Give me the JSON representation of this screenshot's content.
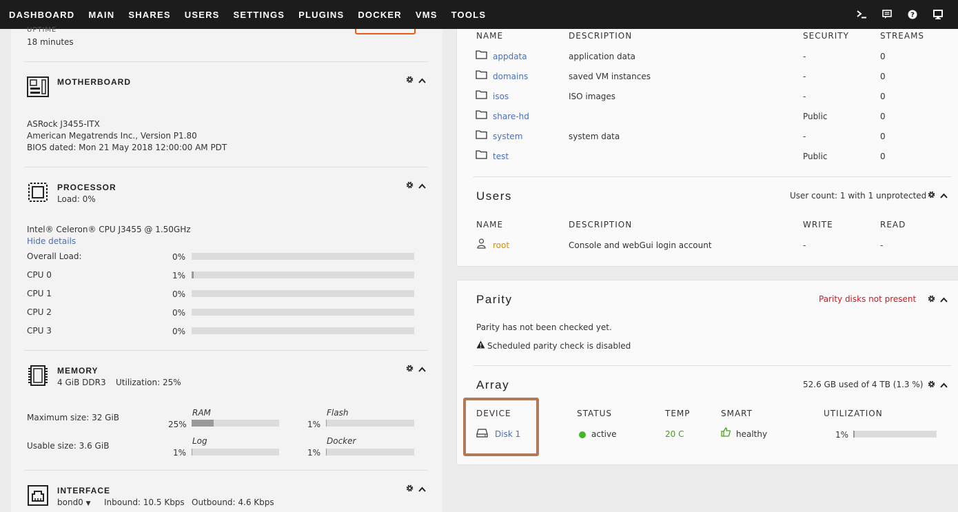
{
  "nav": {
    "items": [
      "DASHBOARD",
      "MAIN",
      "SHARES",
      "USERS",
      "SETTINGS",
      "PLUGINS",
      "DOCKER",
      "VMS",
      "TOOLS"
    ],
    "right_icons": [
      "terminal-icon",
      "feedback-icon",
      "help-icon",
      "monitor-icon"
    ]
  },
  "uptime": {
    "label": "UPTIME",
    "value": "18 minutes"
  },
  "motherboard": {
    "title": "MOTHERBOARD",
    "model": "ASRock J3455-ITX",
    "bios_vendor": "American Megatrends Inc., Version P1.80",
    "bios_date": "BIOS dated: Mon 21 May 2018 12:00:00 AM PDT"
  },
  "processor": {
    "title": "PROCESSOR",
    "load": "Load: 0%",
    "model": "Intel® Celeron® CPU J3455 @ 1.50GHz",
    "hide_details": "Hide details",
    "rows": [
      {
        "label": "Overall Load:",
        "value": "0%",
        "pct": 0
      },
      {
        "label": "CPU 0",
        "value": "1%",
        "pct": 1
      },
      {
        "label": "CPU 1",
        "value": "0%",
        "pct": 0
      },
      {
        "label": "CPU 2",
        "value": "0%",
        "pct": 0
      },
      {
        "label": "CPU 3",
        "value": "0%",
        "pct": 0
      }
    ]
  },
  "memory": {
    "title": "MEMORY",
    "size": "4 GiB DDR3",
    "utilization": "Utilization: 25%",
    "max_size": "Maximum size: 32 GiB",
    "usable_size": "Usable size: 3.6 GiB",
    "bars": [
      {
        "name": "RAM",
        "value": "25%",
        "pct": 25
      },
      {
        "name": "Flash",
        "value": "1%",
        "pct": 1
      },
      {
        "name": "Log",
        "value": "1%",
        "pct": 1
      },
      {
        "name": "Docker",
        "value": "1%",
        "pct": 1
      }
    ]
  },
  "interface": {
    "title": "INTERFACE",
    "selected": "bond0",
    "inbound": "Inbound: 10.5 Kbps",
    "outbound": "Outbound: 4.6 Kbps"
  },
  "shares": {
    "columns": [
      "NAME",
      "DESCRIPTION",
      "SECURITY",
      "STREAMS"
    ],
    "rows": [
      {
        "name": "appdata",
        "description": "application data",
        "security": "-",
        "streams": "0"
      },
      {
        "name": "domains",
        "description": "saved VM instances",
        "security": "-",
        "streams": "0"
      },
      {
        "name": "isos",
        "description": "ISO images",
        "security": "-",
        "streams": "0"
      },
      {
        "name": "share-hd",
        "description": "",
        "security": "Public",
        "streams": "0"
      },
      {
        "name": "system",
        "description": "system data",
        "security": "-",
        "streams": "0"
      },
      {
        "name": "test",
        "description": "",
        "security": "Public",
        "streams": "0"
      }
    ]
  },
  "users": {
    "title": "Users",
    "count": "User count: 1 with 1 unprotected",
    "columns": [
      "NAME",
      "DESCRIPTION",
      "WRITE",
      "READ"
    ],
    "rows": [
      {
        "name": "root",
        "description": "Console and webGui login account",
        "write": "-",
        "read": "-"
      }
    ]
  },
  "parity": {
    "title": "Parity",
    "status": "Parity disks not present",
    "checked": "Parity has not been checked yet.",
    "schedule": "Scheduled parity check is disabled"
  },
  "array": {
    "title": "Array",
    "usage": "52.6 GB used of 4 TB (1.3 %)",
    "columns": [
      "DEVICE",
      "STATUS",
      "TEMP",
      "SMART",
      "UTILIZATION"
    ],
    "rows": [
      {
        "device": "Disk 1",
        "status": "active",
        "temp": "20 C",
        "smart": "healthy",
        "utilization": "1%",
        "pct": 1.3
      }
    ]
  },
  "colors": {
    "accent": "#486dba",
    "orange": "#e48a00",
    "green": "#4a9e1c",
    "red": "#d9141e",
    "nav_bg": "#1c1c1c"
  }
}
